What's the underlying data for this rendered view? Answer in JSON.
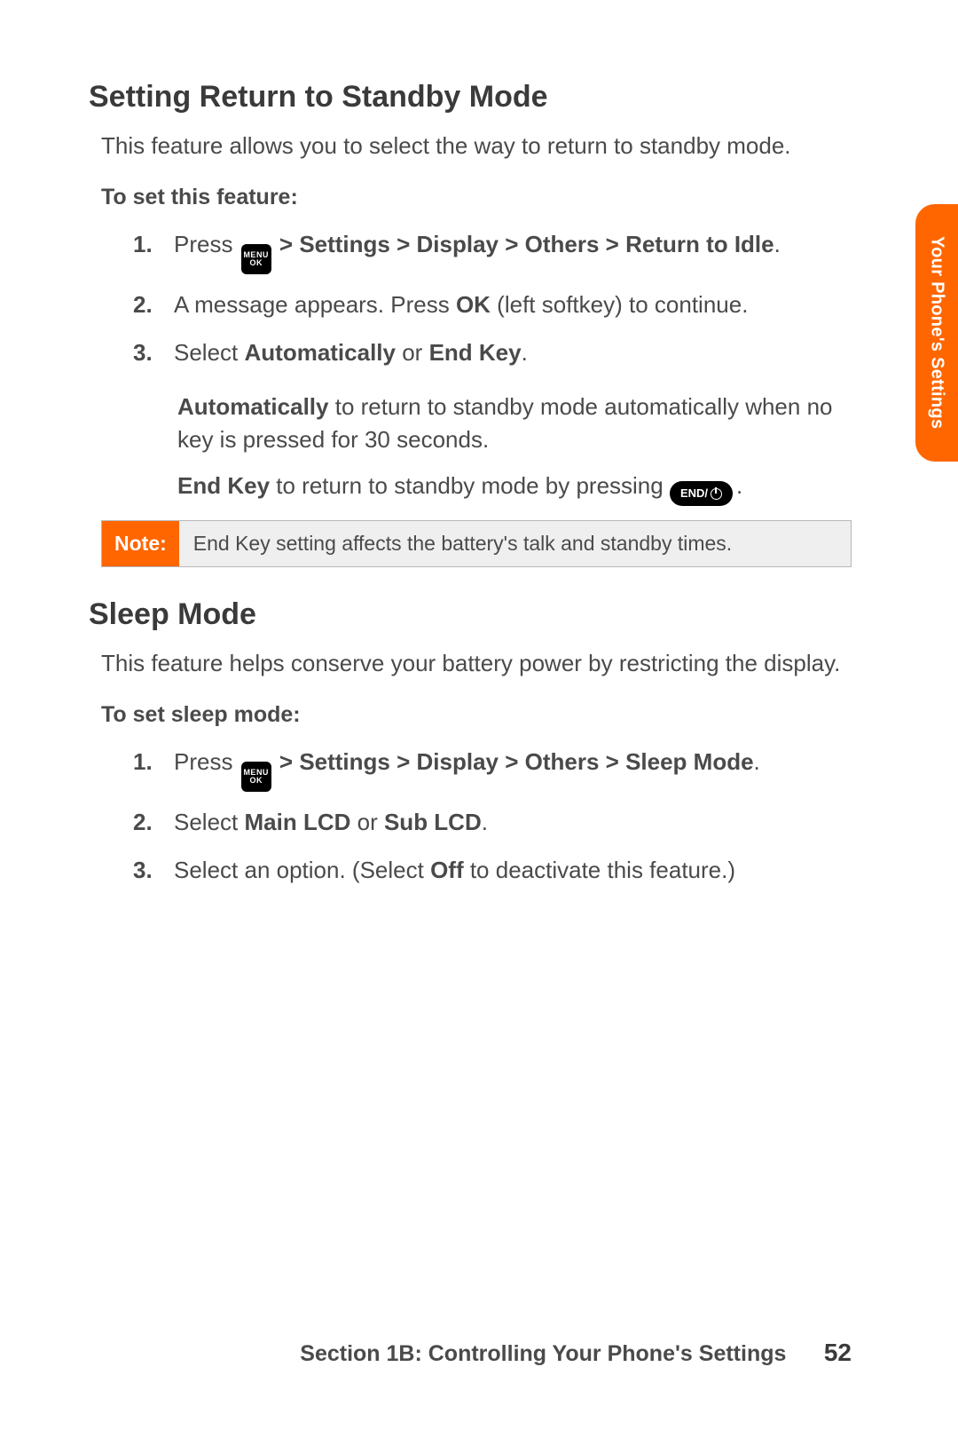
{
  "sideTab": "Your Phone's Settings",
  "section1": {
    "heading": "Setting Return to Standby Mode",
    "intro": "This feature allows you to select the way to return to standby mode.",
    "subhead": "To set this feature:",
    "step1_press": "Press ",
    "step1_path": " > Settings > Display > Others > Return to Idle",
    "step2_a": "A message appears. Press ",
    "step2_ok": "OK",
    "step2_b": " (left softkey) to continue.",
    "step3_a": "Select ",
    "step3_auto": "Automatically",
    "step3_or": " or ",
    "step3_end": "End Key",
    "sub1_a": "Automatically",
    "sub1_b": " to return to standby mode automatically when no key is pressed for 30 seconds.",
    "sub2_a": "End Key",
    "sub2_b": " to return to standby mode by pressing ",
    "noteLabel": "Note:",
    "noteText": "End Key setting affects the battery's talk and standby times."
  },
  "section2": {
    "heading": "Sleep Mode",
    "intro": "This feature helps conserve your battery power by restricting the display.",
    "subhead": "To set sleep mode:",
    "step1_press": "Press ",
    "step1_path": " > Settings > Display > Others > Sleep Mode",
    "step2_a": "Select ",
    "step2_main": "Main LCD",
    "step2_or": " or ",
    "step2_sub": "Sub LCD",
    "step3_a": "Select an option. (Select ",
    "step3_off": "Off",
    "step3_b": " to deactivate this feature.)"
  },
  "footer": {
    "section": "Section 1B: Controlling Your Phone's Settings",
    "page": "52"
  },
  "icons": {
    "menuTop": "MENU",
    "menuBottom": "OK",
    "endLabel": "END/"
  }
}
